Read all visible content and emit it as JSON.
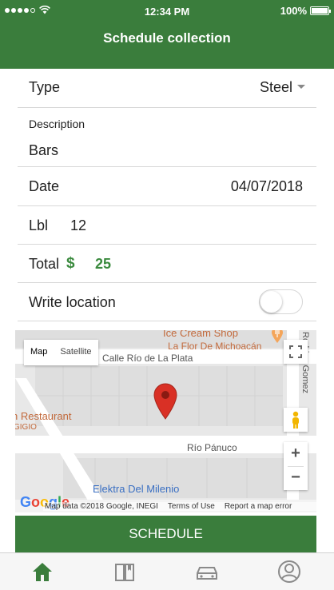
{
  "status_bar": {
    "time": "12:34 PM",
    "battery": "100%",
    "signal_icon": "signal-dots-icon",
    "wifi_icon": "wifi-icon",
    "battery_level": 1.0
  },
  "header": {
    "title": "Schedule collection"
  },
  "form": {
    "type": {
      "label": "Type",
      "value": "Steel"
    },
    "description": {
      "label": "Description",
      "value": "Bars"
    },
    "date": {
      "label": "Date",
      "value": "04/07/2018"
    },
    "lbl": {
      "label": "Lbl",
      "value": "12"
    },
    "total": {
      "label": "Total",
      "currency": "$",
      "value": "25"
    },
    "write_location": {
      "label": "Write location",
      "enabled": false
    }
  },
  "map": {
    "type_options": [
      "Map",
      "Satellite"
    ],
    "selected_type": "Map",
    "labels": {
      "street_1": "Calle Río de La Plata",
      "street_2": "Río Pánuco",
      "poi_1": "Ice Cream Shop",
      "poi_2": "La Flor De Michoacán",
      "poi_3": "n Restaurant",
      "poi_3b": "GIGIO",
      "poi_4": "Elektra Del Milenio",
      "side_street": "Rodrigo Gomez"
    },
    "attribution": {
      "logo": "Google",
      "data": "Map data ©2018 Google, INEGI",
      "terms": "Terms of Use",
      "report": "Report a map error"
    },
    "zoom_in": "+",
    "zoom_out": "−"
  },
  "actions": {
    "schedule_label": "SCHEDULE"
  },
  "tab_bar": {
    "items": [
      {
        "icon": "home-icon",
        "active": true
      },
      {
        "icon": "book-icon",
        "active": false
      },
      {
        "icon": "car-icon",
        "active": false
      },
      {
        "icon": "user-icon",
        "active": false
      }
    ]
  },
  "colors": {
    "primary": "#3a7d3c",
    "accent_green": "#3a8a3e",
    "marker_red": "#d93025"
  }
}
